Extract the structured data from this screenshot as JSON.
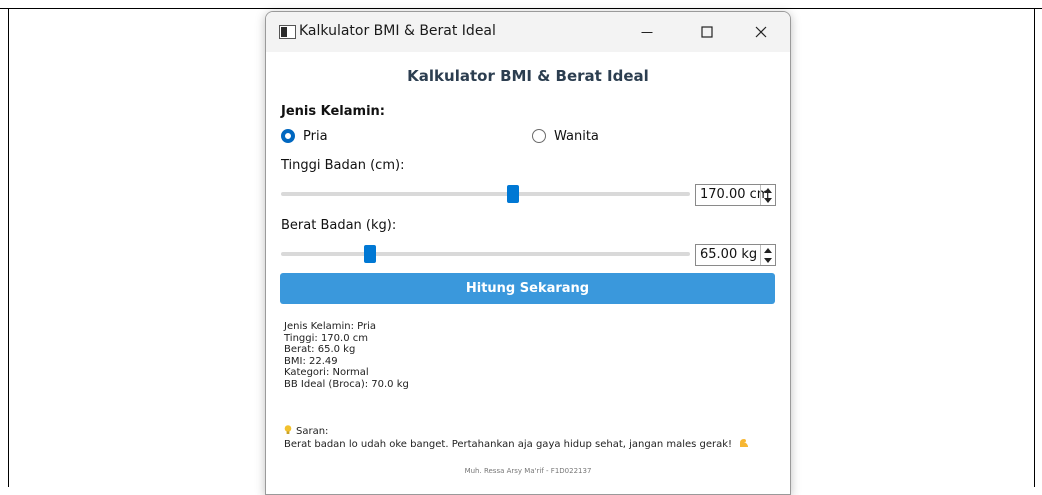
{
  "window": {
    "title": "Kalkulator BMI & Berat Ideal",
    "controls": [
      "minimize-icon",
      "maximize-icon",
      "close-icon"
    ]
  },
  "form": {
    "heading": "Kalkulator BMI & Berat Ideal",
    "gender_label": "Jenis Kelamin:",
    "gender_options": [
      {
        "label": "Pria",
        "selected": true
      },
      {
        "label": "Wanita",
        "selected": false
      }
    ],
    "height_label": "Tinggi Badan (cm):",
    "height_value": "170.00 cm",
    "height_slider_fraction": 0.57,
    "weight_label": "Berat Badan (kg):",
    "weight_value": "65.00 kg",
    "weight_slider_fraction": 0.21,
    "calculate_button": "Hitung Sekarang"
  },
  "result": {
    "lines": [
      "Jenis Kelamin: Pria",
      "Tinggi: 170.0 cm",
      "Berat: 65.0 kg",
      "BMI: 22.49",
      "Kategori: Normal",
      "BB Ideal (Broca): 70.0 kg"
    ],
    "saran_icon": "lightbulb-icon",
    "saran_label": "Saran:",
    "saran_text": "Berat badan lo udah oke banget. Pertahankan aja gaya hidup sehat, jangan males gerak!",
    "saran_emoji": "flexed-biceps-icon"
  },
  "footer": "Muh. Ressa Arsy Ma'rif - F1D022137",
  "colors": {
    "accent": "#0078d4",
    "button": "#3a98dc",
    "heading": "#2c3e50"
  }
}
